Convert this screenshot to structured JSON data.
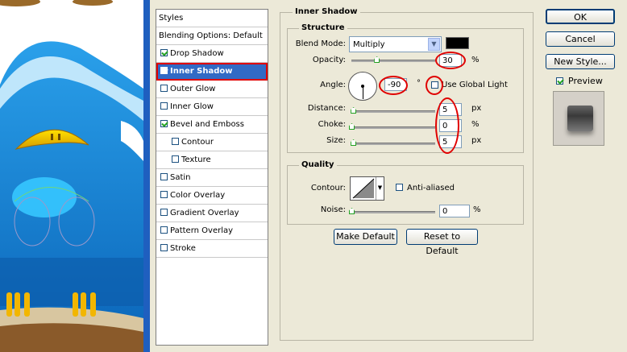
{
  "dialog": {
    "title": "Inner Shadow"
  },
  "styles_panel": {
    "header": "Styles",
    "items": [
      {
        "label": "Blending Options: Default",
        "checkbox": false,
        "checked": false,
        "indent": false,
        "selected": false
      },
      {
        "label": "Drop Shadow",
        "checkbox": true,
        "checked": true,
        "indent": false,
        "selected": false
      },
      {
        "label": "Inner Shadow",
        "checkbox": true,
        "checked": true,
        "indent": false,
        "selected": true
      },
      {
        "label": "Outer Glow",
        "checkbox": true,
        "checked": false,
        "indent": false,
        "selected": false
      },
      {
        "label": "Inner Glow",
        "checkbox": true,
        "checked": false,
        "indent": false,
        "selected": false
      },
      {
        "label": "Bevel and Emboss",
        "checkbox": true,
        "checked": true,
        "indent": false,
        "selected": false
      },
      {
        "label": "Contour",
        "checkbox": true,
        "checked": false,
        "indent": true,
        "selected": false
      },
      {
        "label": "Texture",
        "checkbox": true,
        "checked": false,
        "indent": true,
        "selected": false
      },
      {
        "label": "Satin",
        "checkbox": true,
        "checked": false,
        "indent": false,
        "selected": false
      },
      {
        "label": "Color Overlay",
        "checkbox": true,
        "checked": false,
        "indent": false,
        "selected": false
      },
      {
        "label": "Gradient Overlay",
        "checkbox": true,
        "checked": false,
        "indent": false,
        "selected": false
      },
      {
        "label": "Pattern Overlay",
        "checkbox": true,
        "checked": false,
        "indent": false,
        "selected": false
      },
      {
        "label": "Stroke",
        "checkbox": true,
        "checked": false,
        "indent": false,
        "selected": false
      }
    ]
  },
  "structure": {
    "legend": "Structure",
    "blend_mode": {
      "label": "Blend Mode:",
      "value": "Multiply",
      "swatch_color": "#000000"
    },
    "opacity": {
      "label": "Opacity:",
      "value": "30",
      "unit": "%",
      "level": 0.3
    },
    "angle": {
      "label": "Angle:",
      "value": "-90",
      "unit": "°",
      "global_light_label": "Use Global Light",
      "global_light_checked": false
    },
    "distance": {
      "label": "Distance:",
      "value": "5",
      "unit": "px",
      "level": 0.02
    },
    "choke": {
      "label": "Choke:",
      "value": "0",
      "unit": "%",
      "level": 0.0
    },
    "size": {
      "label": "Size:",
      "value": "5",
      "unit": "px",
      "level": 0.02
    }
  },
  "quality": {
    "legend": "Quality",
    "contour_label": "Contour:",
    "anti_aliased_label": "Anti-aliased",
    "anti_aliased_checked": false,
    "noise": {
      "label": "Noise:",
      "value": "0",
      "unit": "%",
      "level": 0.0
    }
  },
  "buttons": {
    "make_default": "Make Default",
    "reset_default": "Reset to Default",
    "ok": "OK",
    "cancel": "Cancel",
    "new_style": "New Style...",
    "preview_label": "Preview",
    "preview_checked": true
  },
  "colors": {
    "selection": "#316ac5",
    "annotation_red": "#e00000",
    "checkmark_green": "#21a121"
  }
}
